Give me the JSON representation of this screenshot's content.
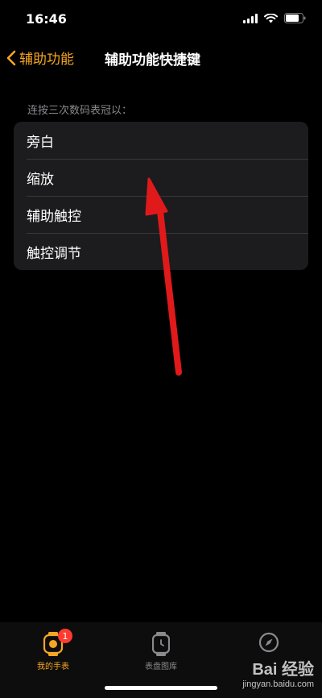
{
  "status_bar": {
    "time": "16:46"
  },
  "nav": {
    "back_label": "辅助功能",
    "title": "辅助功能快捷键"
  },
  "section": {
    "header": "连按三次数码表冠以："
  },
  "options": [
    {
      "label": "旁白"
    },
    {
      "label": "缩放"
    },
    {
      "label": "辅助触控"
    },
    {
      "label": "触控调节"
    }
  ],
  "tab_bar": {
    "tabs": [
      {
        "label": "我的手表",
        "badge": "1",
        "active": true
      },
      {
        "label": "表盘图库",
        "active": false
      },
      {
        "label": "",
        "active": false
      }
    ]
  },
  "watermark": {
    "main": "Bai 经验",
    "sub": "jingyan.baidu.com"
  },
  "colors": {
    "accent": "#f5a623",
    "badge": "#ff3b30",
    "arrow": "#e0191b"
  },
  "icons": {
    "back": "chevron-left-icon",
    "signal": "signal-icon",
    "wifi": "wifi-icon",
    "battery": "battery-icon",
    "my_watch": "watch-icon",
    "face_gallery": "watch-face-icon",
    "discover": "compass-icon"
  }
}
